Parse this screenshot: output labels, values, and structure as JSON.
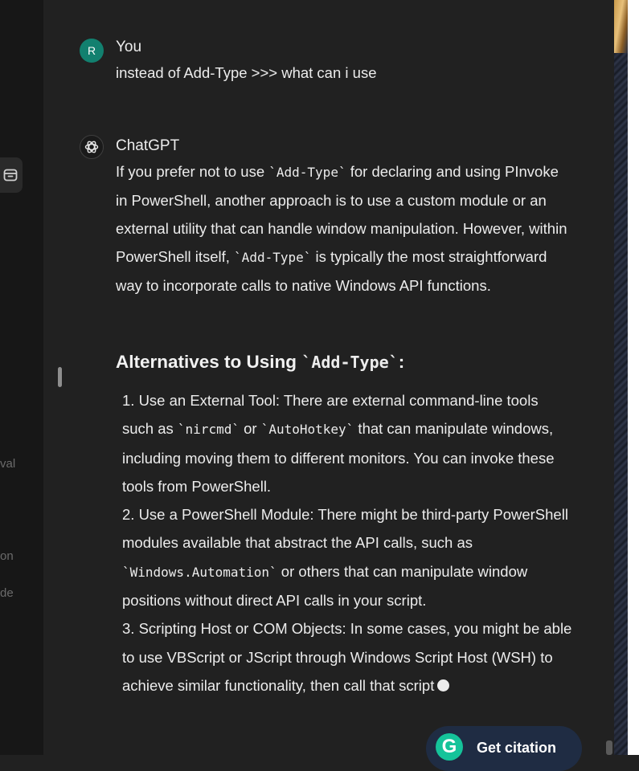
{
  "sidebar": {
    "fragments": [
      "val",
      "on",
      "de"
    ]
  },
  "user_message": {
    "avatar_initial": "R",
    "author": "You",
    "text": "instead of Add-Type  >>> what can i use"
  },
  "assistant_message": {
    "author": "ChatGPT",
    "intro": {
      "t1": "If you prefer not to use ",
      "c1": "`Add-Type`",
      "t2": " for declaring and using PInvoke in PowerShell, another approach is to use a custom module or an external utility that can handle window manipulation. However, within PowerShell itself, ",
      "c2": "`Add-Type`",
      "t3": " is typically the most straightforward way to incorporate calls to native Windows API functions."
    },
    "heading": {
      "t1": "Alternatives to Using ",
      "c1": "`Add-Type`",
      "t2": ":"
    },
    "items": [
      {
        "t1": "1. Use an External Tool: There are external command-line tools such as ",
        "c1": "`nircmd`",
        "t2": " or ",
        "c2": "`AutoHotkey`",
        "t3": " that can manipulate windows, including moving them to different monitors. You can invoke these tools from PowerShell."
      },
      {
        "t1": "2. Use a PowerShell Module: There might be third-party PowerShell modules available that abstract the API calls, such as ",
        "c1": "`Windows.Automation`",
        "t2": " or others that can manipulate window positions without direct API calls in your script."
      },
      {
        "t1": "3. Scripting Host or COM Objects: In some cases, you might be able to use VBScript or JScript through Windows Script Host (WSH) to achieve similar functionality, then call that script"
      }
    ]
  },
  "citation_button": {
    "icon_letter": "G",
    "label": "Get citation"
  },
  "colors": {
    "background": "#212121",
    "sidebar": "#171717",
    "user_avatar": "#12806f",
    "grammarly_green": "#15c39a",
    "citation_bg": "#1f2c43"
  },
  "icons": {
    "sidebar_button": "archive-icon",
    "assistant_avatar": "openai-logo-icon",
    "citation": "grammarly-g-icon"
  }
}
